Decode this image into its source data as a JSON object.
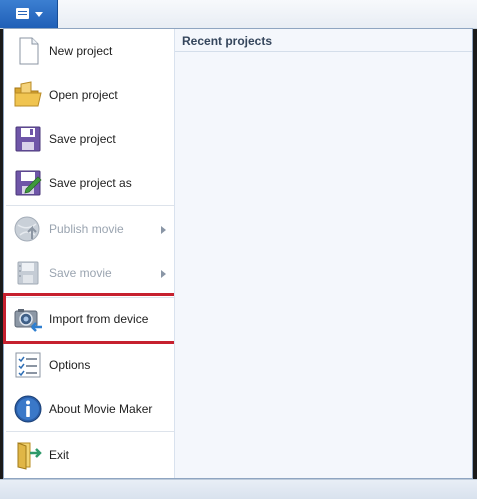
{
  "menu": {
    "items": [
      {
        "label": "New project"
      },
      {
        "label": "Open project"
      },
      {
        "label": "Save project"
      },
      {
        "label": "Save project as"
      },
      {
        "label": "Publish movie"
      },
      {
        "label": "Save movie"
      },
      {
        "label": "Import from device"
      },
      {
        "label": "Options"
      },
      {
        "label": "About Movie Maker"
      },
      {
        "label": "Exit"
      }
    ]
  },
  "recent": {
    "title": "Recent projects"
  },
  "icons": {
    "app_menu": "app-menu-icon",
    "new": "new-document-icon",
    "open": "folder-icon",
    "save": "floppy-disk-icon",
    "save_as": "floppy-disk-edit-icon",
    "publish": "globe-upload-icon",
    "save_movie": "film-disk-icon",
    "import": "camera-import-icon",
    "options": "checklist-icon",
    "about": "info-icon",
    "exit": "exit-door-icon"
  },
  "colors": {
    "app_button": "#1f5fb7",
    "highlight": "#c6202e",
    "disabled_text": "#9aa4b0"
  }
}
